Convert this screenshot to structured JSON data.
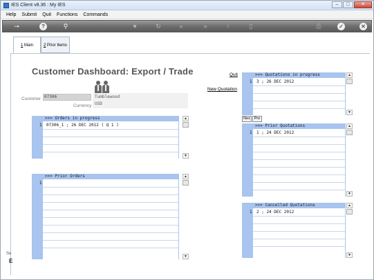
{
  "window": {
    "title": "IES Client v8.36 : My IES",
    "min": "–",
    "max": "□",
    "close": "✕"
  },
  "menu": [
    "Help",
    "Submit",
    "Quit",
    "Functions",
    "Commands"
  ],
  "toolbar": {
    "icons": [
      {
        "name": "key-icon",
        "glyph": "⊸"
      },
      {
        "name": "help-icon",
        "glyph": "?"
      },
      {
        "name": "search-icon",
        "glyph": "⚲"
      },
      {
        "name": "favorite-icon",
        "glyph": "♥"
      },
      {
        "name": "refresh-icon",
        "glyph": "↻"
      },
      {
        "name": "rewind-icon",
        "glyph": "«"
      },
      {
        "name": "forward-icon",
        "glyph": "»"
      },
      {
        "name": "upload-icon",
        "glyph": "↑"
      },
      {
        "name": "document-icon",
        "glyph": "▯"
      },
      {
        "name": "print-icon",
        "glyph": "⎙"
      },
      {
        "name": "confirm-icon",
        "glyph": "✓"
      },
      {
        "name": "cancel-icon",
        "glyph": "✕"
      }
    ]
  },
  "tabs": [
    {
      "key": "1",
      "label": " Main"
    },
    {
      "key": "2",
      "label": " Prior Items"
    }
  ],
  "heading": "Customer Dashboard: Export / Trade",
  "customer": {
    "label": "Customer",
    "code": "07306",
    "name": "Tumblewood",
    "currency_label": "Currency",
    "currency": "USD"
  },
  "links": {
    "quit": "Quit",
    "new_quotation": "New Quotation"
  },
  "panels": {
    "orders_in_progress": {
      "title": ">>> Orders in progress",
      "rows": [
        {
          "num": "1",
          "text": "07306_1 ; 26 DEC 2012 ( Q 1 )"
        }
      ]
    },
    "prior_orders": {
      "title": ">>> Prior Orders",
      "rows": [
        {
          "num": "1",
          "text": ""
        }
      ]
    },
    "quotations_in_progress": {
      "title": ">>> Quotations in progress",
      "rows": [
        {
          "num": "1",
          "text": "3 ; 26 DEC 2012"
        }
      ]
    },
    "prior_quotations": {
      "title": ">>> Prior Quotations",
      "rows": [
        {
          "num": "1",
          "text": "1 ; 24 DEC 2012"
        }
      ]
    },
    "cancelled_quotations": {
      "title": ">>> Cancelled Quotations",
      "rows": [
        {
          "num": "1",
          "text": "2 ; 24 DEC 2012"
        }
      ]
    }
  },
  "nav_buttons": {
    "next": "Nex",
    "prev": "Pre"
  },
  "scroll_glyphs": {
    "up": "▲",
    "down": "▼"
  },
  "side_fragments": {
    "top": "Se",
    "bottom": "E"
  }
}
